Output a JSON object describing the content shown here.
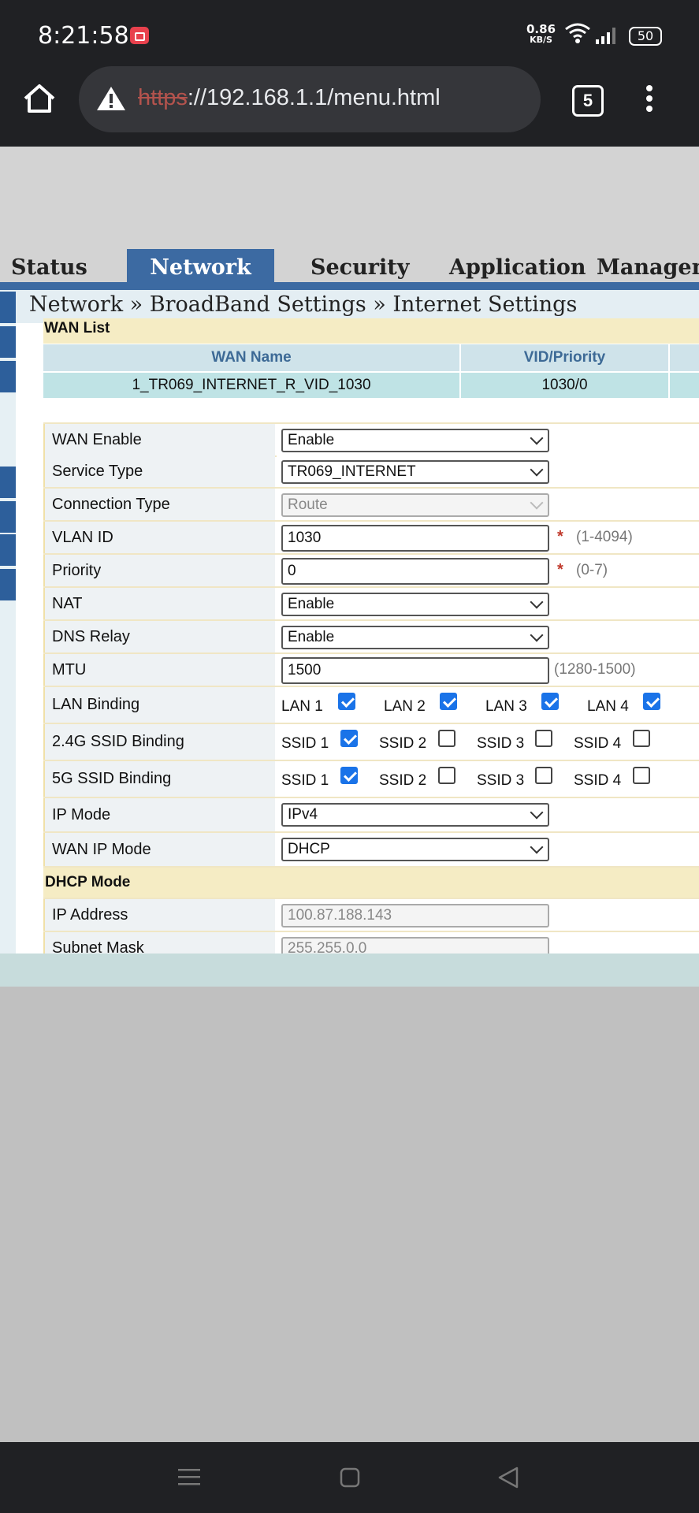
{
  "status_bar": {
    "time": "8:21:58",
    "net_speed_value": "0.86",
    "net_speed_unit": "KB/S",
    "battery": "50"
  },
  "browser": {
    "url_scheme": "https",
    "url_rest": "://192.168.1.1/menu.html",
    "tab_count": "5"
  },
  "nav_tabs": [
    "Status",
    "Network",
    "Security",
    "Application",
    "Managem"
  ],
  "active_tab": "Network",
  "breadcrumb": "Network » BroadBand Settings » Internet Settings",
  "wan_list": {
    "title": "WAN List",
    "headers": [
      "WAN Name",
      "VID/Priority"
    ],
    "rows": [
      [
        "1_TR069_INTERNET_R_VID_1030",
        "1030/0"
      ]
    ]
  },
  "form": {
    "wan_enable": {
      "label": "WAN Enable",
      "value": "Enable"
    },
    "service_type": {
      "label": "Service Type",
      "value": "TR069_INTERNET"
    },
    "connection_type": {
      "label": "Connection Type",
      "value": "Route"
    },
    "vlan_id": {
      "label": "VLAN ID",
      "value": "1030",
      "required": "*",
      "hint": "(1-4094)"
    },
    "priority": {
      "label": "Priority",
      "value": "0",
      "required": "*",
      "hint": "(0-7)"
    },
    "nat": {
      "label": "NAT",
      "value": "Enable"
    },
    "dns_relay": {
      "label": "DNS Relay",
      "value": "Enable"
    },
    "mtu": {
      "label": "MTU",
      "value": "1500",
      "hint": "(1280-1500)"
    },
    "lan_binding": {
      "label": "LAN Binding",
      "options": [
        {
          "label": "LAN 1",
          "checked": true
        },
        {
          "label": "LAN 2",
          "checked": true
        },
        {
          "label": "LAN 3",
          "checked": true
        },
        {
          "label": "LAN 4",
          "checked": true
        }
      ]
    },
    "ssid24_binding": {
      "label": "2.4G SSID Binding",
      "options": [
        {
          "label": "SSID 1",
          "checked": true
        },
        {
          "label": "SSID 2",
          "checked": false
        },
        {
          "label": "SSID 3",
          "checked": false
        },
        {
          "label": "SSID 4",
          "checked": false
        }
      ]
    },
    "ssid5_binding": {
      "label": "5G SSID Binding",
      "options": [
        {
          "label": "SSID 1",
          "checked": true
        },
        {
          "label": "SSID 2",
          "checked": false
        },
        {
          "label": "SSID 3",
          "checked": false
        },
        {
          "label": "SSID 4",
          "checked": false
        }
      ]
    },
    "ip_mode": {
      "label": "IP Mode",
      "value": "IPv4"
    },
    "wan_ip_mode": {
      "label": "WAN IP Mode",
      "value": "DHCP"
    },
    "dhcp_title": "DHCP Mode",
    "ip_address": {
      "label": "IP Address",
      "value": "100.87.188.143"
    },
    "subnet_mask": {
      "label": "Subnet Mask",
      "value": "255.255.0.0"
    }
  },
  "colors": {
    "accent": "#3c6aa2",
    "checkbox_checked": "#1a73e8",
    "required": "#c0392b"
  }
}
